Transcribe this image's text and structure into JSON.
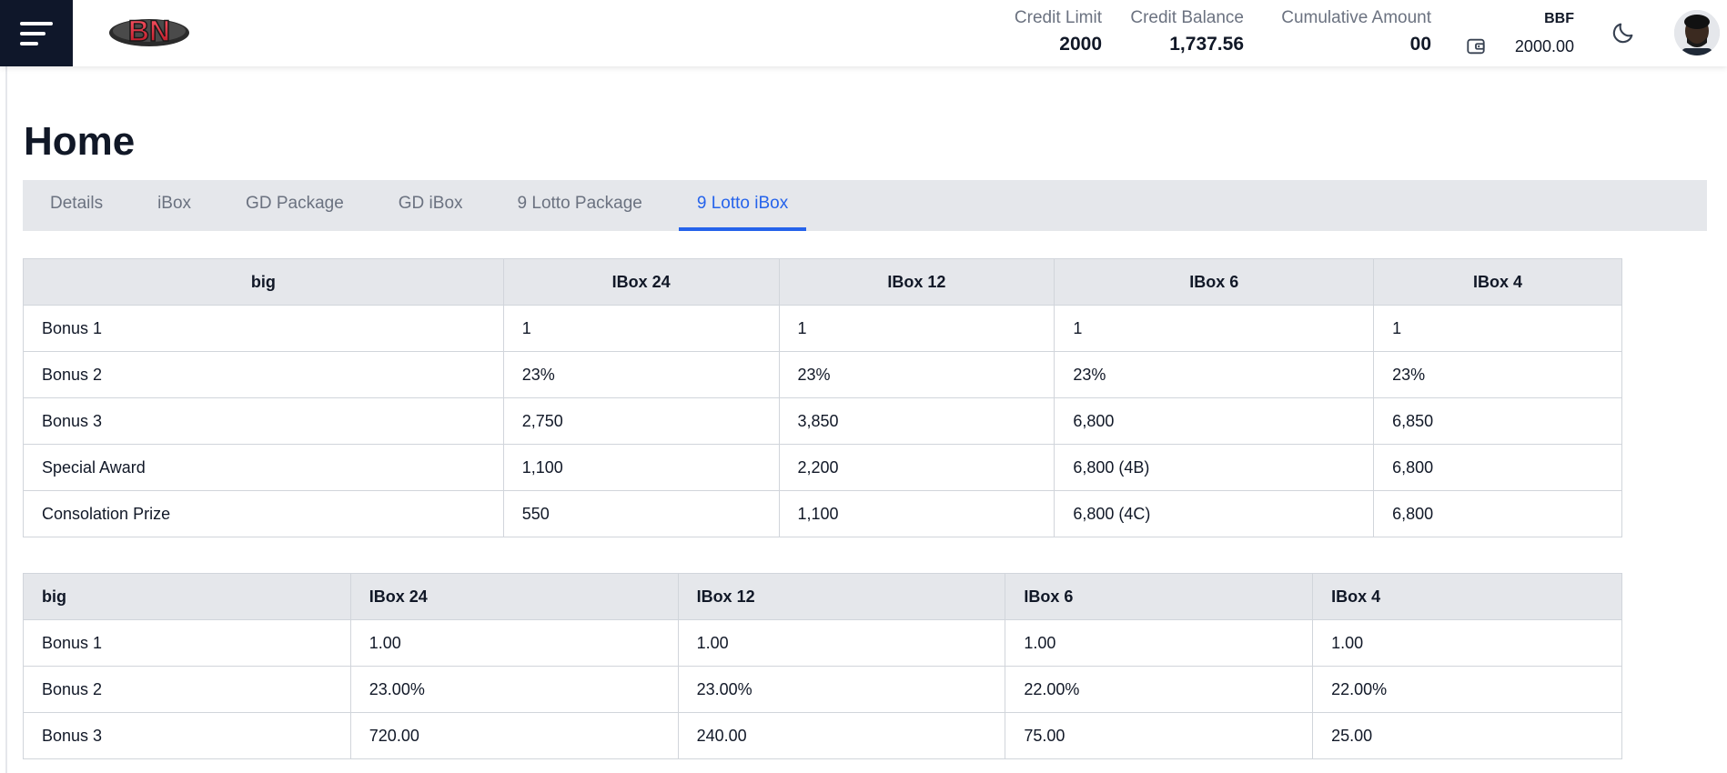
{
  "header": {
    "logo_text": "BN",
    "stats": [
      {
        "label": "Credit Limit",
        "value": "2000"
      },
      {
        "label": "Credit Balance",
        "value": "1,737.56"
      },
      {
        "label": "Cumulative Amount",
        "value": "00"
      }
    ],
    "wallet": {
      "currency": "BBF",
      "amount": "2000.00"
    },
    "icons": [
      "menu-icon",
      "wallet-icon",
      "moon-icon",
      "avatar"
    ]
  },
  "page": {
    "title": "Home"
  },
  "tabs": [
    {
      "label": "Details"
    },
    {
      "label": "iBox"
    },
    {
      "label": "GD Package"
    },
    {
      "label": "GD iBox"
    },
    {
      "label": "9 Lotto Package"
    },
    {
      "label": "9 Lotto iBox",
      "active": true
    }
  ],
  "table1": {
    "headers": [
      "big",
      "IBox 24",
      "IBox 12",
      "IBox 6",
      "IBox 4"
    ],
    "rows": [
      [
        "Bonus 1",
        "1",
        "1",
        "1",
        "1"
      ],
      [
        "Bonus 2",
        "23%",
        "23%",
        "23%",
        "23%"
      ],
      [
        "Bonus 3",
        "2,750",
        "3,850",
        "6,800",
        "6,850"
      ],
      [
        "Special Award",
        "1,100",
        "2,200",
        "6,800 (4B)",
        "6,800"
      ],
      [
        "Consolation Prize",
        "550",
        "1,100",
        "6,800 (4C)",
        "6,800"
      ]
    ]
  },
  "table2": {
    "headers": [
      "big",
      "IBox 24",
      "IBox 12",
      "IBox 6",
      "IBox 4"
    ],
    "rows": [
      [
        "Bonus 1",
        "1.00",
        "1.00",
        "1.00",
        "1.00"
      ],
      [
        "Bonus 2",
        "23.00%",
        "23.00%",
        "22.00%",
        "22.00%"
      ],
      [
        "Bonus 3",
        "720.00",
        "240.00",
        "75.00",
        "25.00"
      ]
    ]
  },
  "colors": {
    "menu_bg": "#0f172a",
    "accent": "#2563eb",
    "tab_bar_bg": "#e5e7eb",
    "table_header_bg": "#e5e7eb",
    "border": "#d1d5db"
  }
}
